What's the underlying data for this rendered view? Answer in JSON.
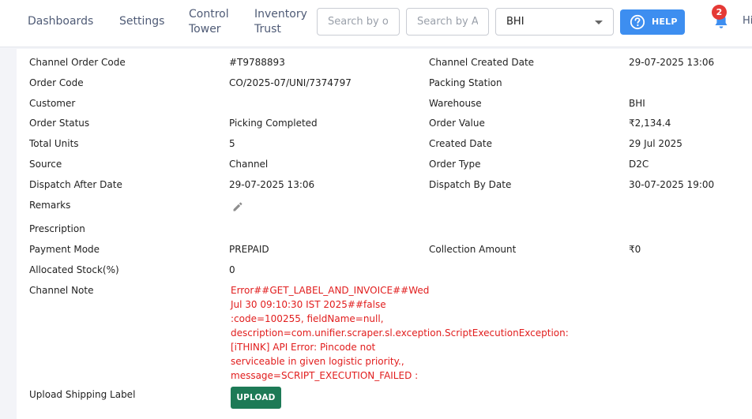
{
  "nav": {
    "dashboards": "Dashboards",
    "settings": "Settings",
    "control_tower": "Control\nTower",
    "inventory_trust": "Inventory\nTrust"
  },
  "search": {
    "placeholder_1": "Search by o",
    "placeholder_2": "Search by A"
  },
  "facility": {
    "selected": "BHI"
  },
  "help": {
    "label": "HELP"
  },
  "notifications": {
    "count": "2"
  },
  "user": {
    "greeting": "Hi"
  },
  "colors": {
    "help_blue": "#3d8ef0",
    "upload_green": "#1d7a56",
    "error_red": "#e11d1d",
    "badge_red": "#e53935"
  },
  "details": {
    "channel_order_code_label": "Channel Order Code",
    "channel_order_code": "#T9788893",
    "channel_created_date_label": "Channel Created Date",
    "channel_created_date": "29-07-2025 13:06",
    "order_code_label": "Order Code",
    "order_code": "CO/2025-07/UNI/7374797",
    "packing_station_label": "Packing Station",
    "packing_station": "",
    "customer_label": "Customer",
    "customer": "",
    "warehouse_label": "Warehouse",
    "warehouse": "BHI",
    "order_status_label": "Order Status",
    "order_status": "Picking Completed",
    "order_value_label": "Order Value",
    "order_value": "₹2,134.4",
    "total_units_label": "Total Units",
    "total_units": "5",
    "created_date_label": "Created Date",
    "created_date": "29 Jul 2025",
    "source_label": "Source",
    "source": "Channel",
    "order_type_label": "Order Type",
    "order_type": "D2C",
    "dispatch_after_label": "Dispatch After Date",
    "dispatch_after": "29-07-2025 13:06",
    "dispatch_by_label": "Dispatch By Date",
    "dispatch_by": "30-07-2025 19:00",
    "remarks_label": "Remarks",
    "prescription_label": "Prescription",
    "payment_mode_label": "Payment Mode",
    "payment_mode": "PREPAID",
    "collection_amount_label": "Collection Amount",
    "collection_amount": "₹0",
    "allocated_stock_label": "Allocated Stock(%)",
    "allocated_stock": "0",
    "channel_note_label": "Channel Note",
    "channel_note": "Error##GET_LABEL_AND_INVOICE##Wed\nJul 30 09:10:30 IST 2025##false\n:code=100255, fieldName=null,\ndescription=com.unifier.scraper.sl.exception.ScriptExecutionException:\n[iTHINK] API Error: Pincode not\nserviceable in given logistic priority.,\nmessage=SCRIPT_EXECUTION_FAILED :",
    "upload_shipping_label_label": "Upload Shipping Label",
    "upload_button": "UPLOAD"
  }
}
